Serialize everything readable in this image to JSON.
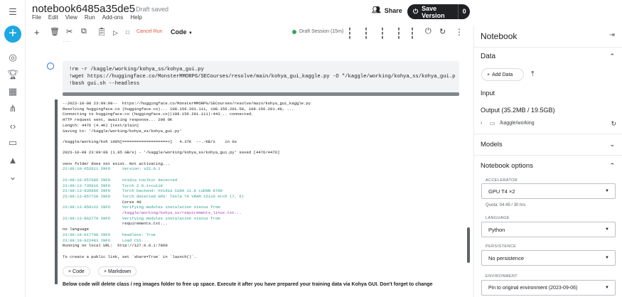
{
  "header": {
    "title": "notebook6485a35de5",
    "status": "Draft saved",
    "menu": [
      "File",
      "Edit",
      "View",
      "Run",
      "Add-ons",
      "Help"
    ],
    "share_label": "Share",
    "save_version_label": "Save Version",
    "save_version_count": "0"
  },
  "toolbar": {
    "cancel_run": "Cancel Run",
    "cell_type": "Code",
    "session": "Draft Session (15m)"
  },
  "cell": {
    "lines": [
      "!rm -r /kaggle/working/kohya_ss/kohya_gui.py",
      "!wget https://huggingface.co/MonsterMMORPG/SECourses/resolve/main/kohya_gui_kaggle.py -O \"/kaggle/working/kohya_ss/kohya_gui.p",
      "!bash gui.sh --headless"
    ]
  },
  "output": {
    "lines": [
      "--2023-10-08 23:09:09--  https://huggingface.co/MonsterMMORPG/SECourses/resolve/main/kohya_gui_kaggle.py",
      "Resolving huggingface.co (huggingface.co)... 108.156.201.111, 108.156.201.58, 108.156.201.48, ...",
      "Connecting to huggingface.co (huggingface.co)|108.156.201.111|:443... connected.",
      "HTTP request sent, awaiting response... 200 OK",
      "Length: 4476 (4.4K) [text/plain]",
      "Saving to: '/kaggle/working/kohya_ss/kohya_gui.py'",
      "",
      "/kaggle/working/koh 100%[===================>]   4.37K  --.-KB/s    in 0s",
      "",
      "2023-10-08 23:09:09 (1.85 GB/s) - '/kaggle/working/kohya_ss/kohya_gui.py' saved [4476/4476]",
      "",
      "venv folder does not exist. Not activating...",
      "23:09:10-652611 INFO     Version: v22.0.1",
      "",
      "23:09:10-657686 INFO     nVidia toolkit detected",
      "23:09:13-735816 INFO     Torch 2.0.1+cu118",
      "23:09:13-835666 INFO     Torch backend: nVidia CUDA 11.8 cuDNN 8700",
      "23:09:13-857720 INFO     Torch detected GPU: Tesla T4 VRAM 15110 Arch (7, 5)",
      "                         Cores 40",
      "23:09:13-859122 INFO     Verifying modules instalation status from",
      "                         /kaggle/working/kohya_ss/requirements_linux.txt...",
      "23:09:13-862779 INFO     Verifying modules instalation status from",
      "                         requirements.txt...",
      "no language",
      "23:09:19-017708 INFO     headless: True",
      "23:09:19-022483 INFO     Load CSS...",
      "Running on local URL:  http://127.0.0.1:7860",
      "",
      "To create a public link, set `share=True` in `launch()`."
    ]
  },
  "actions": {
    "add_code": "+ Code",
    "add_markdown": "+ Markdown"
  },
  "note": "Below code will delete class / reg images folder to free up space. Execute it after you have prepared your training data via Kohya GUI. Don't forget to change",
  "panel": {
    "title": "Notebook",
    "data_heading": "Data",
    "add_data": "Add Data",
    "input_heading": "Input",
    "output_heading": "Output (35.2MB / 19.5GB)",
    "output_path": "/kaggle/working",
    "models_heading": "Models",
    "options_heading": "Notebook options",
    "accelerator_label": "ACCELERATOR",
    "accelerator_value": "GPU T4 ×2",
    "quota": "Quota: 04:49 / 30 hrs",
    "language_label": "LANGUAGE",
    "language_value": "Python",
    "persistence_label": "PERSISTENCE",
    "persistence_value": "No persistence",
    "environment_label": "ENVIRONMENT",
    "environment_value": "Pin to original environment (2023-09-06)"
  },
  "colors": {
    "accent": "#1ea7e1",
    "cancel": "#e8553f",
    "session_dot": "#3ca55c",
    "link": "#1a73e8",
    "log_info": "#2a9d8f"
  }
}
